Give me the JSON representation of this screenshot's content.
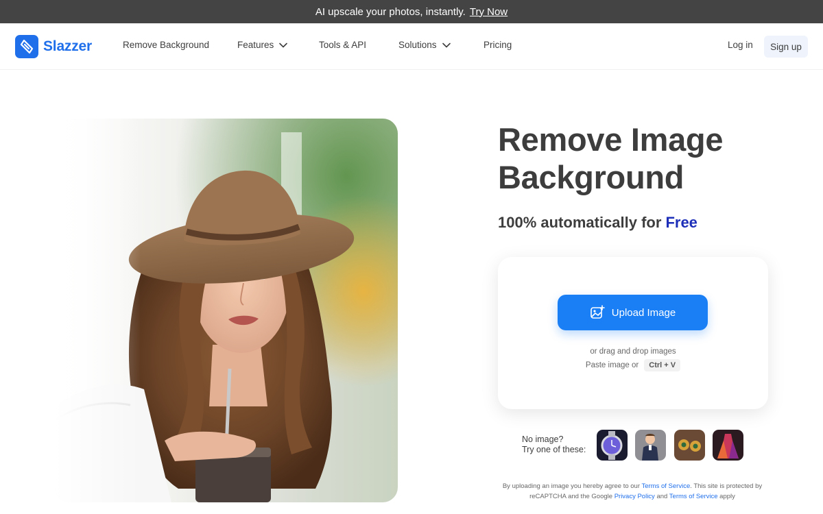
{
  "promo": {
    "text": "AI upscale your photos, instantly.",
    "link": "Try Now"
  },
  "nav": {
    "logo_text": "Slazzer",
    "items": [
      {
        "label": "Remove Background",
        "dropdown": false
      },
      {
        "label": "Features",
        "dropdown": true
      },
      {
        "label": "Tools & API",
        "dropdown": false
      },
      {
        "label": "Solutions",
        "dropdown": true
      },
      {
        "label": "Pricing",
        "dropdown": false
      }
    ],
    "login": "Log in",
    "signup": "Sign up"
  },
  "hero": {
    "title": "Remove Image Background",
    "subtitle_prefix": "100% automatically for",
    "subtitle_highlight": "Free"
  },
  "upload": {
    "button": "Upload Image",
    "drag_text": "or drag and drop images",
    "paste_text": "Paste image or",
    "shortcut": "Ctrl + V"
  },
  "samples": {
    "line1": "No image?",
    "line2": "Try one of these:",
    "thumbs": [
      "watch",
      "child",
      "earrings",
      "dress"
    ]
  },
  "legal": {
    "part1": "By uploading an image you hereby agree to our",
    "tos": "Terms of Service",
    "part2": ". This site is protected by reCAPTCHA and the Google",
    "privacy": "Privacy Policy",
    "part3": "and",
    "tos2": "Terms of Service",
    "part4": "apply"
  },
  "colors": {
    "brand": "#1f6feb",
    "upload_button": "#1a7ff5",
    "free_highlight": "#1d2fb8",
    "promo_bg": "#444444"
  }
}
